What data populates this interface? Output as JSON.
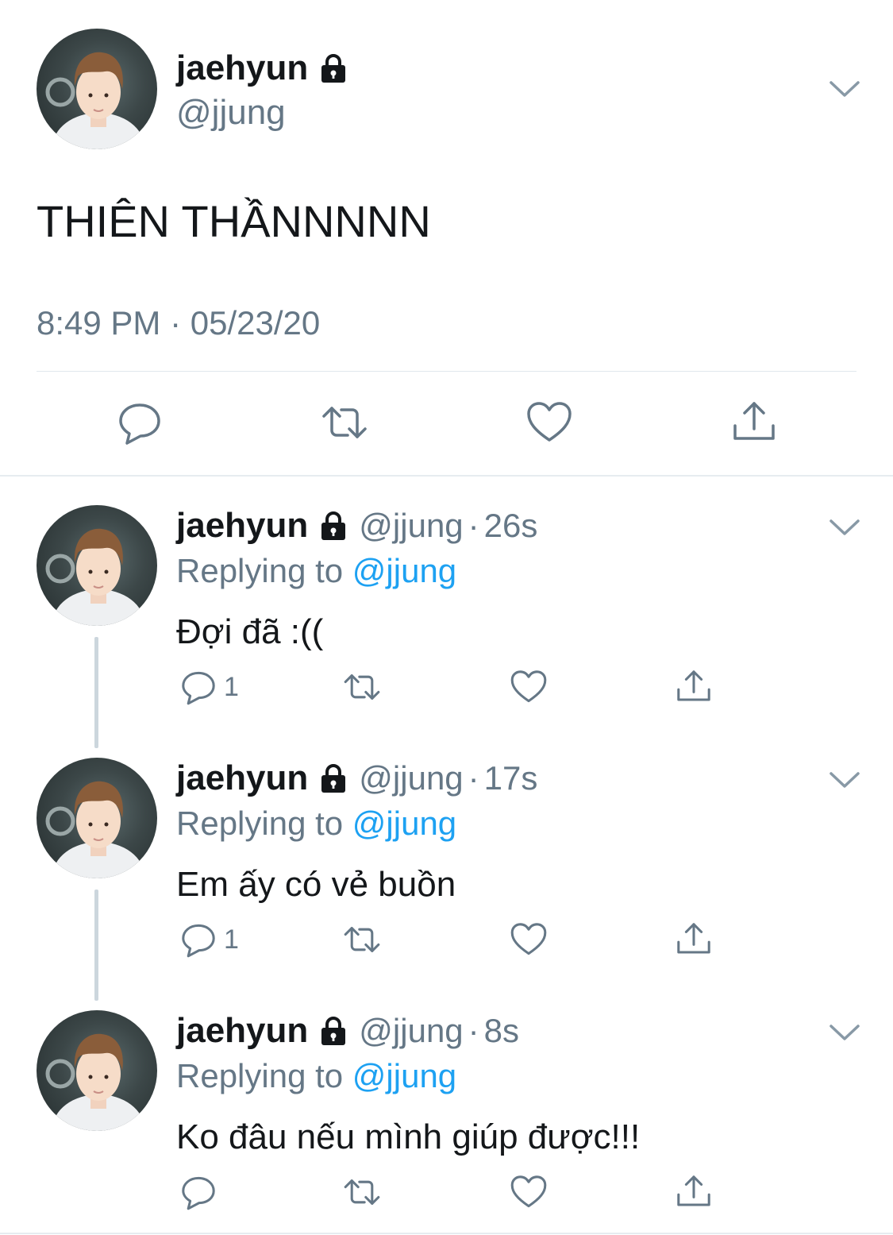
{
  "main_tweet": {
    "display_name": "jaehyun",
    "handle": "@jjung",
    "text": "THIÊN THẦNNNNN",
    "timestamp": "8:49 PM · 05/23/20",
    "icons": [
      "lock-icon",
      "chevron-down-icon",
      "reply-icon",
      "retweet-icon",
      "like-icon",
      "share-icon"
    ]
  },
  "replies": [
    {
      "display_name": "jaehyun",
      "handle": "@jjung",
      "dot": "·",
      "time": "26s",
      "replying_prefix": "Replying to ",
      "replying_mention": "@jjung",
      "text": "Đợi đã :((",
      "reply_count": "1"
    },
    {
      "display_name": "jaehyun",
      "handle": "@jjung",
      "dot": "·",
      "time": "17s",
      "replying_prefix": "Replying to ",
      "replying_mention": "@jjung",
      "text": "Em ấy có vẻ buồn",
      "reply_count": "1"
    },
    {
      "display_name": "jaehyun",
      "handle": "@jjung",
      "dot": "·",
      "time": "8s",
      "replying_prefix": "Replying to ",
      "replying_mention": "@jjung",
      "text": "Ko đâu nếu mình giúp được!!!",
      "reply_count": ""
    }
  ],
  "colors": {
    "text_primary": "#14171a",
    "text_secondary": "#657786",
    "mention": "#1da1f2",
    "divider": "#e1e8ed",
    "thread_line": "#ccd6dd"
  }
}
